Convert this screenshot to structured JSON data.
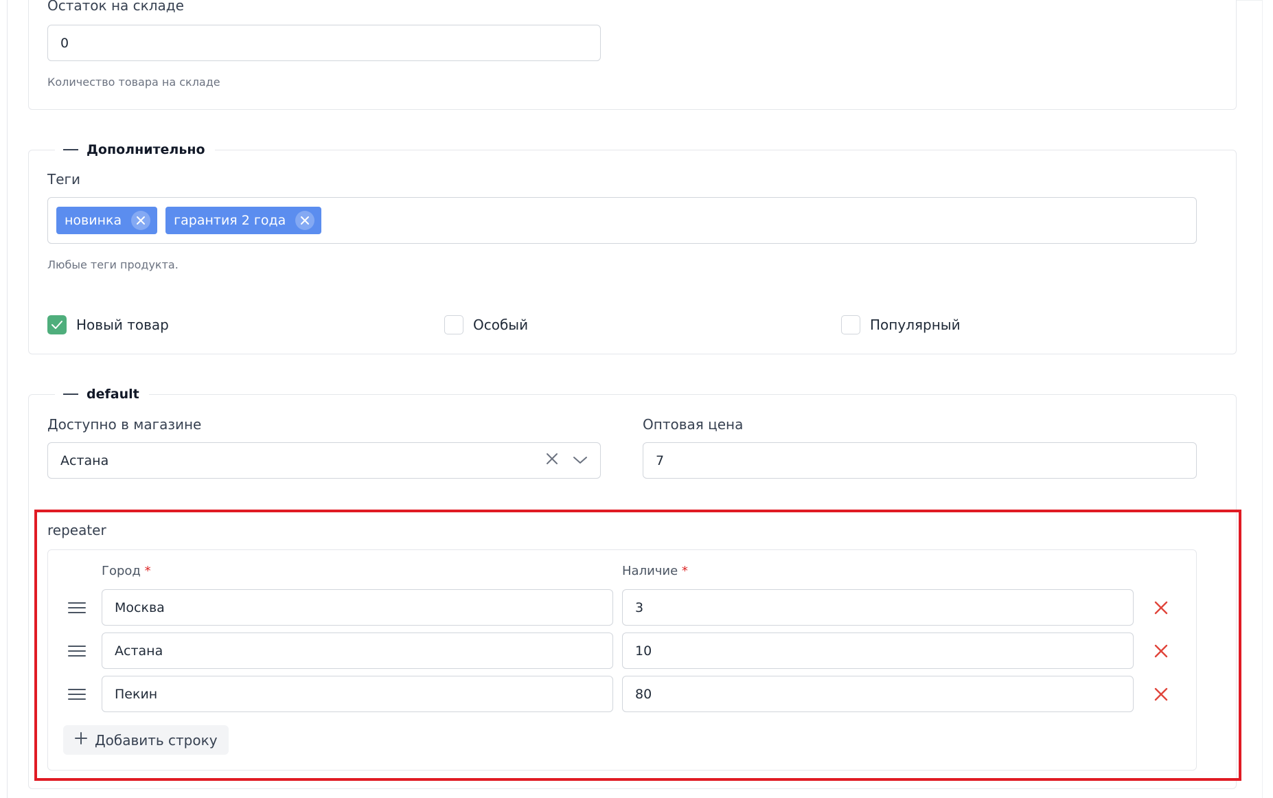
{
  "stock": {
    "label": "Остаток на складе",
    "value": "0",
    "help": "Количество товара на складе"
  },
  "additional": {
    "legend": "Дополнительно",
    "tags_label": "Теги",
    "tags": [
      "новинка",
      "гарантия 2 года"
    ],
    "tags_help": "Любые теги продукта.",
    "checkboxes": [
      {
        "label": "Новый товар",
        "checked": true
      },
      {
        "label": "Особый",
        "checked": false
      },
      {
        "label": "Популярный",
        "checked": false
      }
    ]
  },
  "default_section": {
    "legend": "default",
    "store_label": "Доступно в магазине",
    "store_value": "Астана",
    "wholesale_label": "Оптовая цена",
    "wholesale_value": "7"
  },
  "repeater": {
    "label": "repeater",
    "columns": [
      {
        "label": "Город",
        "required_mark": "*"
      },
      {
        "label": "Наличие",
        "required_mark": "*"
      }
    ],
    "rows": [
      {
        "city": "Москва",
        "availability": "3"
      },
      {
        "city": "Астана",
        "availability": "10"
      },
      {
        "city": "Пекин",
        "availability": "80"
      }
    ],
    "add_row_label": "Добавить строку"
  },
  "colors": {
    "tag_bg": "#5b8def",
    "checkbox_checked": "#4fae7c",
    "delete_red": "#e0443a",
    "highlight_red": "#e01b24"
  }
}
